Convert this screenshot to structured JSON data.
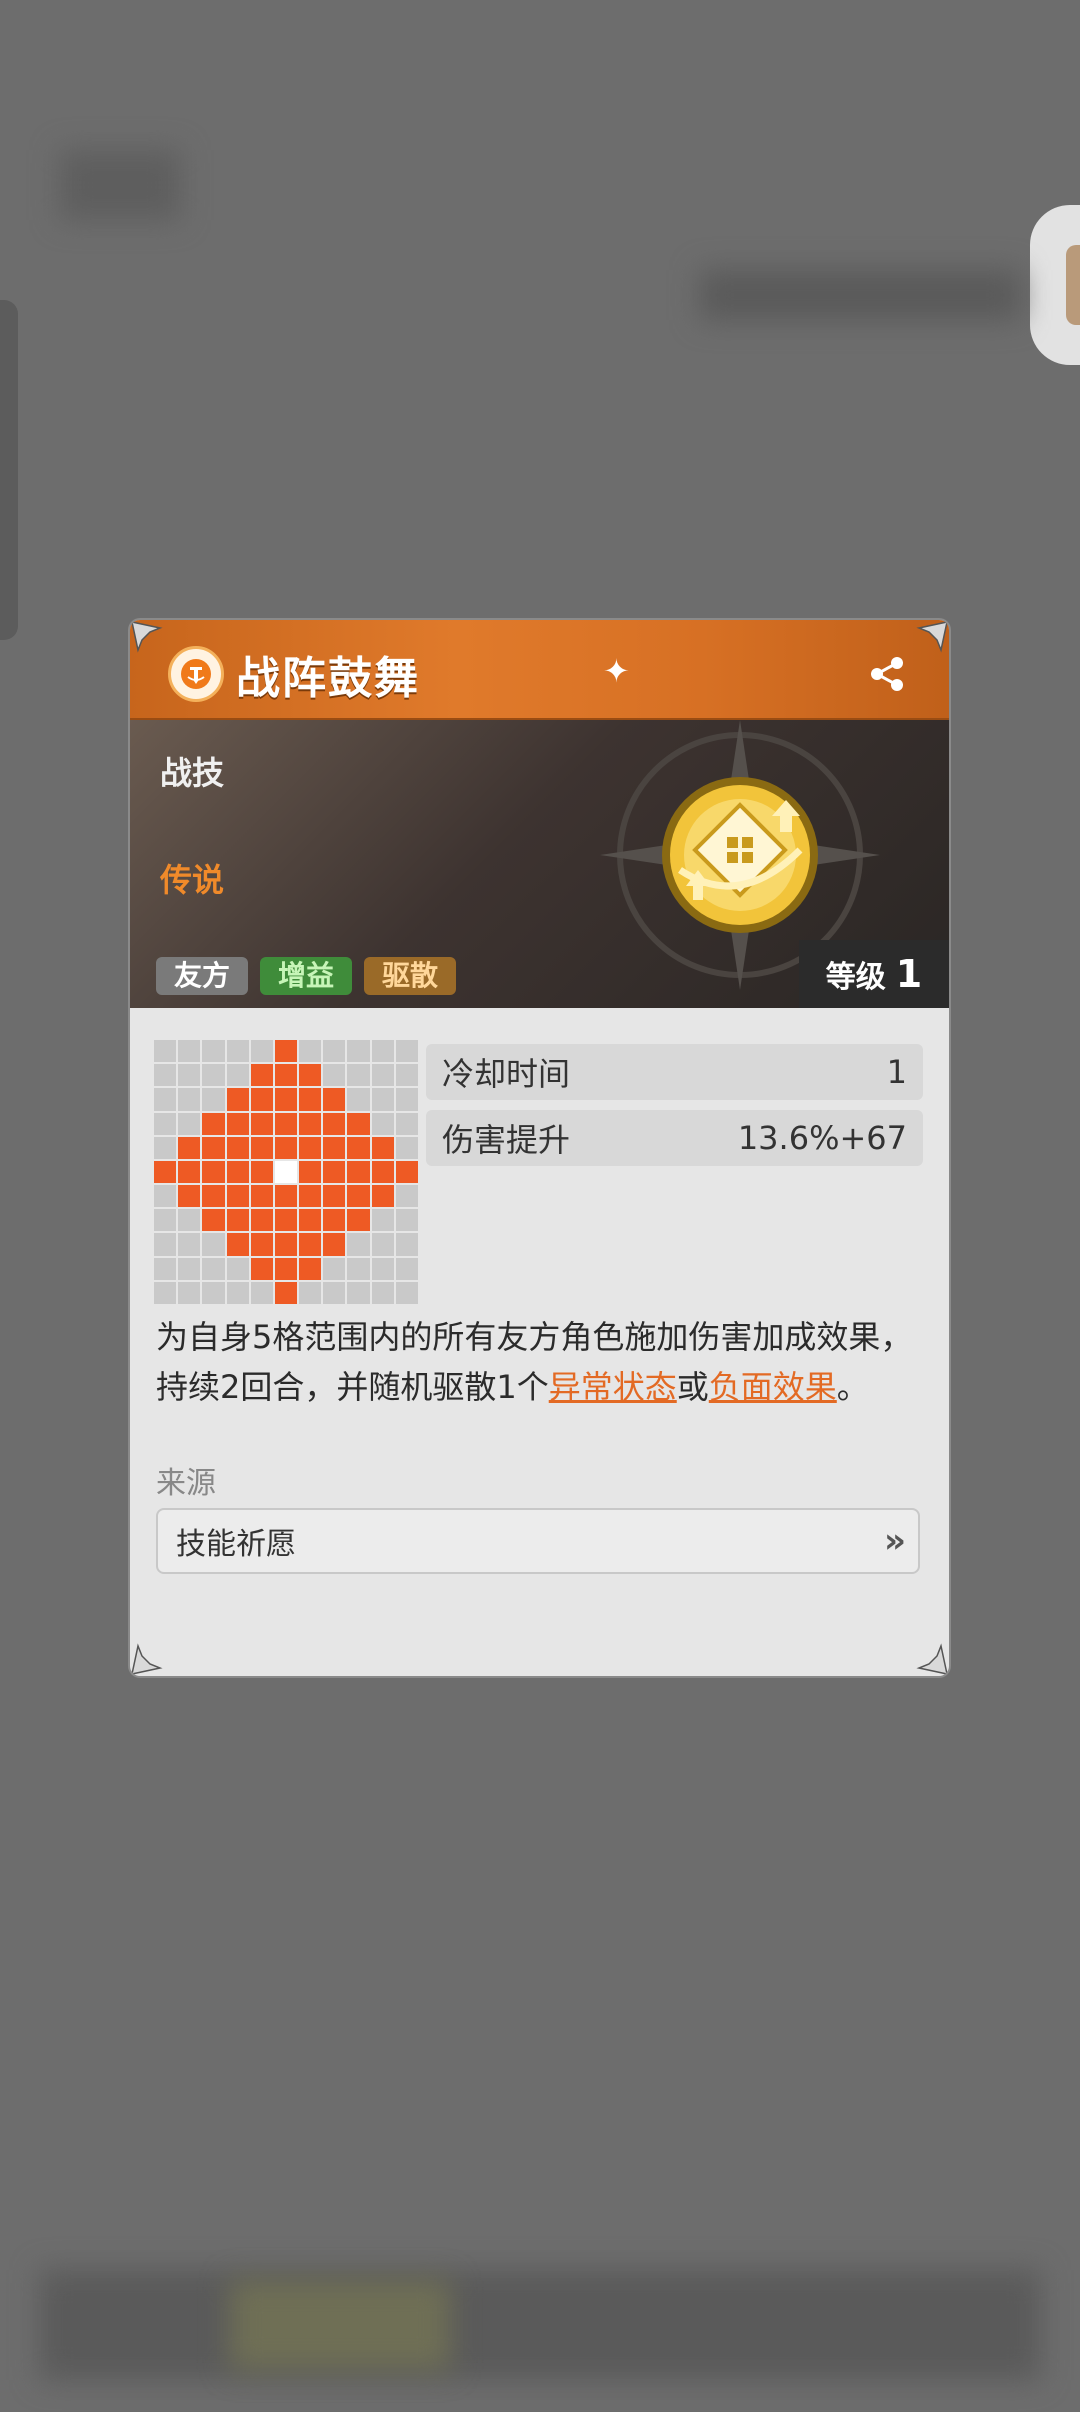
{
  "skill": {
    "name": "战阵鼓舞",
    "type": "战技",
    "rarity": "传说",
    "tags": [
      "友方",
      "增益",
      "驱散"
    ],
    "level_label": "等级",
    "level_value": "1"
  },
  "stats": [
    {
      "label": "冷却时间",
      "value": "1"
    },
    {
      "label": "伤害提升",
      "value": "13.6%+67"
    }
  ],
  "description": {
    "line1": "为自身5格范围内的所有友方角色施加伤害加成效果，",
    "line2_a": "持续2回合，并随机驱散1个",
    "link1": "异常状态",
    "or": "或",
    "link2": "负面效果",
    "end": "。"
  },
  "source": {
    "label": "来源",
    "item": "技能祈愿"
  },
  "colors": {
    "accent": "#e07a2b",
    "range_active": "#ee5a24",
    "range_inactive": "#c9c9c9"
  }
}
